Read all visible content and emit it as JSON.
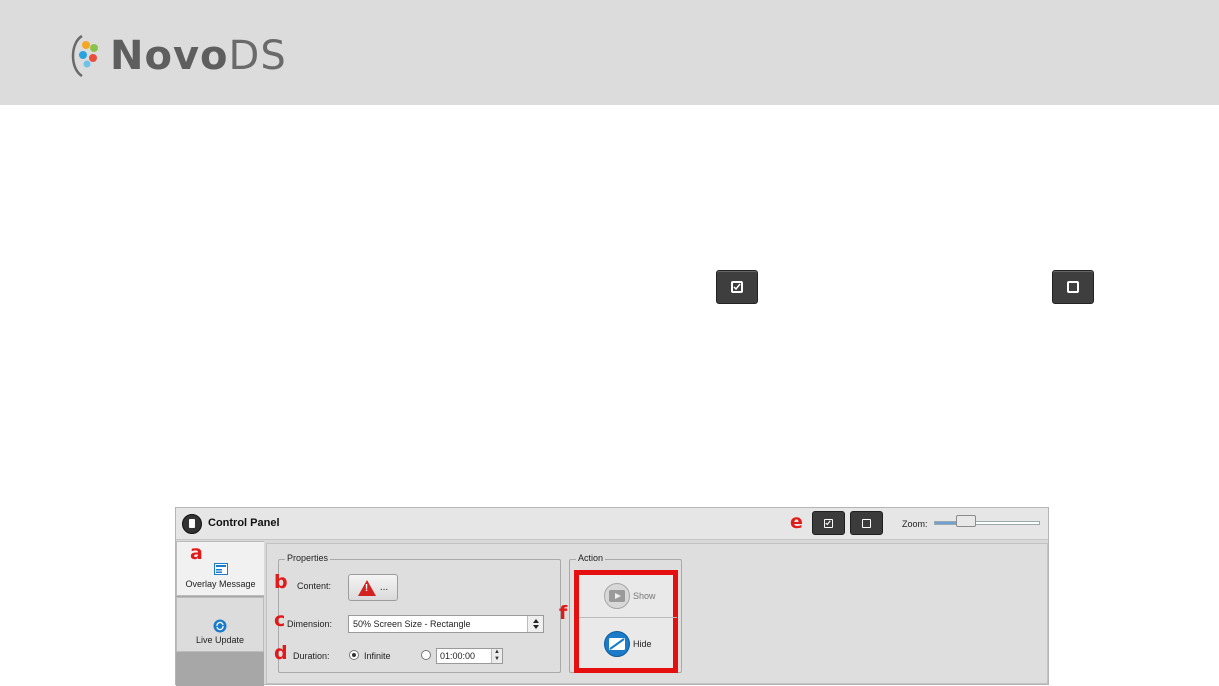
{
  "brand": {
    "name_part1": "Novo",
    "name_part2": "DS"
  },
  "top_buttons": {
    "left_icon": "checkbox-icon",
    "right_icon": "square-icon"
  },
  "control_panel": {
    "title": "Control Panel",
    "zoom_label": "Zoom:",
    "zoom_level": 0.3,
    "markers": {
      "a": "a",
      "b": "b",
      "c": "c",
      "d": "d",
      "e": "e",
      "f": "f"
    },
    "sidebar": {
      "tabs": [
        {
          "label": "Overlay Message",
          "icon": "overlay-message-icon",
          "active": true
        },
        {
          "label": "Live Update",
          "icon": "live-update-icon",
          "active": false
        }
      ]
    },
    "properties": {
      "title": "Properties",
      "content_label": "Content:",
      "content_button_text": "...",
      "dimension_label": "Dimension:",
      "dimension_value": "50% Screen Size - Rectangle",
      "duration_label": "Duration:",
      "duration_infinite": "Infinite",
      "duration_time": "01:00:00"
    },
    "action": {
      "title": "Action",
      "show_label": "Show",
      "hide_label": "Hide"
    },
    "colors": {
      "highlight": "#e60f0f",
      "accent_blue": "#1a7cc9"
    }
  }
}
